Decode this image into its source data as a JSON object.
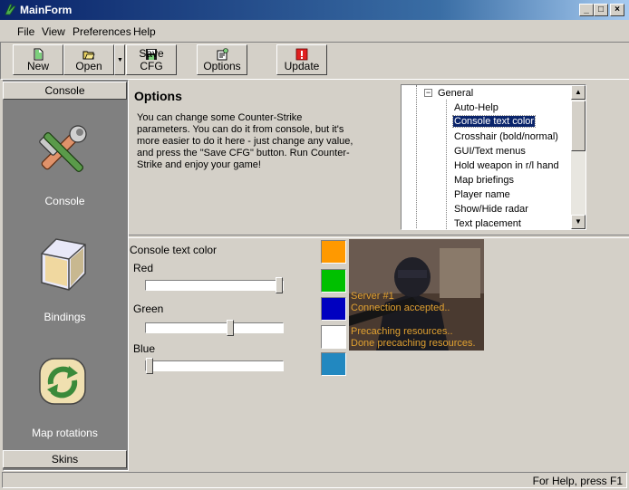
{
  "window": {
    "title": "MainForm",
    "title_bar_color": "#0a246a"
  },
  "menu": [
    "File",
    "View",
    "Preferences",
    "Help"
  ],
  "toolbar": {
    "new": "New",
    "open": "Open",
    "save": "Save CFG",
    "options": "Options",
    "update": "Update"
  },
  "left_panel": {
    "header": "Console",
    "items": [
      "Console",
      "Bindings",
      "Map rotations"
    ],
    "footer": "Skins"
  },
  "options": {
    "heading": "Options",
    "description": "You can change some Counter-Strike parameters. You can do it from console, but it's more easier to do it here - just change any value, and press the \"Save CFG\" button. Run Counter-Strike and enjoy your game!"
  },
  "tree": {
    "root": "General",
    "items": [
      "Auto-Help",
      "Console text color",
      "Crosshair (bold/normal)",
      "GUI/Text menus",
      "Hold weapon in r/l hand",
      "Map briefings",
      "Player name",
      "Show/Hide radar",
      "Text placement"
    ],
    "selected": "Console text color"
  },
  "color_editor": {
    "label": "Console text color",
    "red_label": "Red",
    "green_label": "Green",
    "blue_label": "Blue",
    "red_value": 1.0,
    "green_value": 0.62,
    "blue_value": 0.0,
    "swatches": [
      "#ff9900",
      "#00c000",
      "#0000c0",
      "#ffffff",
      "#2288c0"
    ]
  },
  "preview": {
    "lines": [
      "Server #1",
      "Connection accepted..",
      "",
      "Precaching resources..",
      "Done precaching resources."
    ],
    "text_color": "#e0a030"
  },
  "status": {
    "help": "For Help, press F1"
  }
}
